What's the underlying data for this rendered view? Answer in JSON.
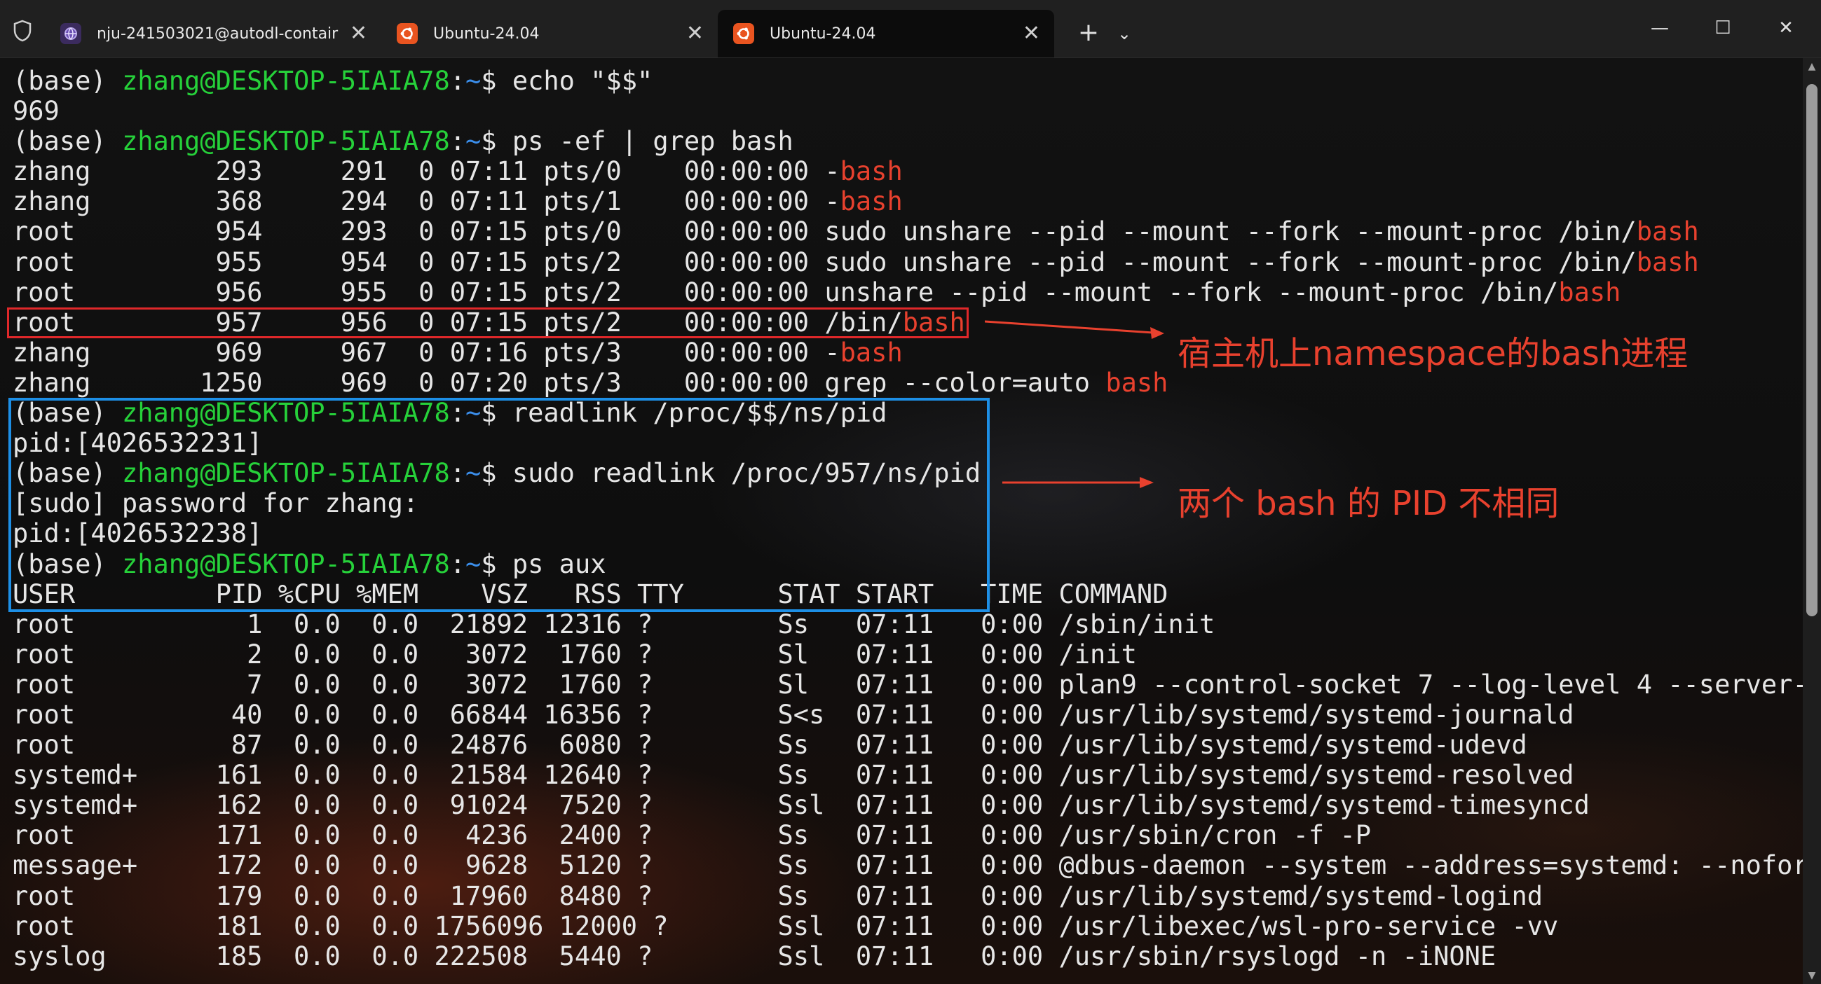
{
  "tabs": [
    {
      "label": "nju-241503021@autodl-contair",
      "icon": "globe-icon",
      "close": "✕"
    },
    {
      "label": "Ubuntu-24.04",
      "icon": "ubuntu-icon",
      "close": "✕"
    },
    {
      "label": "Ubuntu-24.04",
      "icon": "ubuntu-icon",
      "close": "✕",
      "active": true
    }
  ],
  "titlebar": {
    "new_tab": "+",
    "dropdown": "⌄",
    "minimize": "—",
    "maximize": "☐",
    "close": "✕"
  },
  "colors": {
    "prompt_user": "#26d13a",
    "prompt_path": "#3b8eea",
    "match": "#e8412e",
    "box_red": "#e0282a",
    "box_blue": "#1d8fe6"
  },
  "terminal": {
    "lines": [
      [
        {
          "t": "(base) "
        },
        {
          "t": "zhang@DESKTOP-5IAIA78",
          "c": "g"
        },
        {
          "t": ":"
        },
        {
          "t": "~",
          "c": "b"
        },
        {
          "t": "$ echo \"$$\""
        }
      ],
      [
        {
          "t": "969"
        }
      ],
      [
        {
          "t": "(base) "
        },
        {
          "t": "zhang@DESKTOP-5IAIA78",
          "c": "g"
        },
        {
          "t": ":"
        },
        {
          "t": "~",
          "c": "b"
        },
        {
          "t": "$ ps -ef | grep bash"
        }
      ],
      [
        {
          "t": "zhang        293     291  0 07:11 pts/0    00:00:00 -"
        },
        {
          "t": "bash",
          "c": "r"
        }
      ],
      [
        {
          "t": "zhang        368     294  0 07:11 pts/1    00:00:00 -"
        },
        {
          "t": "bash",
          "c": "r"
        }
      ],
      [
        {
          "t": "root         954     293  0 07:15 pts/0    00:00:00 sudo unshare --pid --mount --fork --mount-proc /bin/"
        },
        {
          "t": "bash",
          "c": "r"
        }
      ],
      [
        {
          "t": "root         955     954  0 07:15 pts/2    00:00:00 sudo unshare --pid --mount --fork --mount-proc /bin/"
        },
        {
          "t": "bash",
          "c": "r"
        }
      ],
      [
        {
          "t": "root         956     955  0 07:15 pts/2    00:00:00 unshare --pid --mount --fork --mount-proc /bin/"
        },
        {
          "t": "bash",
          "c": "r"
        }
      ],
      [
        {
          "t": "root         957     956  0 07:15 pts/2    00:00:00 /bin/"
        },
        {
          "t": "bash",
          "c": "r"
        }
      ],
      [
        {
          "t": "zhang        969     967  0 07:16 pts/3    00:00:00 -"
        },
        {
          "t": "bash",
          "c": "r"
        }
      ],
      [
        {
          "t": "zhang       1250     969  0 07:20 pts/3    00:00:00 grep --color=auto "
        },
        {
          "t": "bash",
          "c": "r"
        }
      ],
      [
        {
          "t": "(base) "
        },
        {
          "t": "zhang@DESKTOP-5IAIA78",
          "c": "g"
        },
        {
          "t": ":"
        },
        {
          "t": "~",
          "c": "b"
        },
        {
          "t": "$ readlink /proc/$$/ns/pid"
        }
      ],
      [
        {
          "t": "pid:[4026532231]"
        }
      ],
      [
        {
          "t": "(base) "
        },
        {
          "t": "zhang@DESKTOP-5IAIA78",
          "c": "g"
        },
        {
          "t": ":"
        },
        {
          "t": "~",
          "c": "b"
        },
        {
          "t": "$ sudo readlink /proc/957/ns/pid"
        }
      ],
      [
        {
          "t": "[sudo] password for zhang:"
        }
      ],
      [
        {
          "t": "pid:[4026532238]"
        }
      ],
      [
        {
          "t": "(base) "
        },
        {
          "t": "zhang@DESKTOP-5IAIA78",
          "c": "g"
        },
        {
          "t": ":"
        },
        {
          "t": "~",
          "c": "b"
        },
        {
          "t": "$ ps aux"
        }
      ],
      [
        {
          "t": "USER         PID %CPU %MEM    VSZ   RSS TTY      STAT START   TIME COMMAND"
        }
      ],
      [
        {
          "t": "root           1  0.0  0.0  21892 12316 ?        Ss   07:11   0:00 /sbin/init"
        }
      ],
      [
        {
          "t": "root           2  0.0  0.0   3072  1760 ?        Sl   07:11   0:00 /init"
        }
      ],
      [
        {
          "t": "root           7  0.0  0.0   3072  1760 ?        Sl   07:11   0:00 plan9 --control-socket 7 --log-level 4 --server-"
        }
      ],
      [
        {
          "t": "root          40  0.0  0.0  66844 16356 ?        S<s  07:11   0:00 /usr/lib/systemd/systemd-journald"
        }
      ],
      [
        {
          "t": "root          87  0.0  0.0  24876  6080 ?        Ss   07:11   0:00 /usr/lib/systemd/systemd-udevd"
        }
      ],
      [
        {
          "t": "systemd+     161  0.0  0.0  21584 12640 ?        Ss   07:11   0:00 /usr/lib/systemd/systemd-resolved"
        }
      ],
      [
        {
          "t": "systemd+     162  0.0  0.0  91024  7520 ?        Ssl  07:11   0:00 /usr/lib/systemd/systemd-timesyncd"
        }
      ],
      [
        {
          "t": "root         171  0.0  0.0   4236  2400 ?        Ss   07:11   0:00 /usr/sbin/cron -f -P"
        }
      ],
      [
        {
          "t": "message+     172  0.0  0.0   9628  5120 ?        Ss   07:11   0:00 @dbus-daemon --system --address=systemd: --nofor"
        }
      ],
      [
        {
          "t": "root         179  0.0  0.0  17960  8480 ?        Ss   07:11   0:00 /usr/lib/systemd/systemd-logind"
        }
      ],
      [
        {
          "t": "root         181  0.0  0.0 1756096 12000 ?       Ssl  07:11   0:00 /usr/libexec/wsl-pro-service -vv"
        }
      ],
      [
        {
          "t": "syslog       185  0.0  0.0 222508  5440 ?        Ssl  07:11   0:00 /usr/sbin/rsyslogd -n -iNONE"
        }
      ]
    ]
  },
  "annotations": {
    "text1": "宿主机上namespace的bash进程",
    "text2": "两个 bash 的 PID 不相同"
  }
}
